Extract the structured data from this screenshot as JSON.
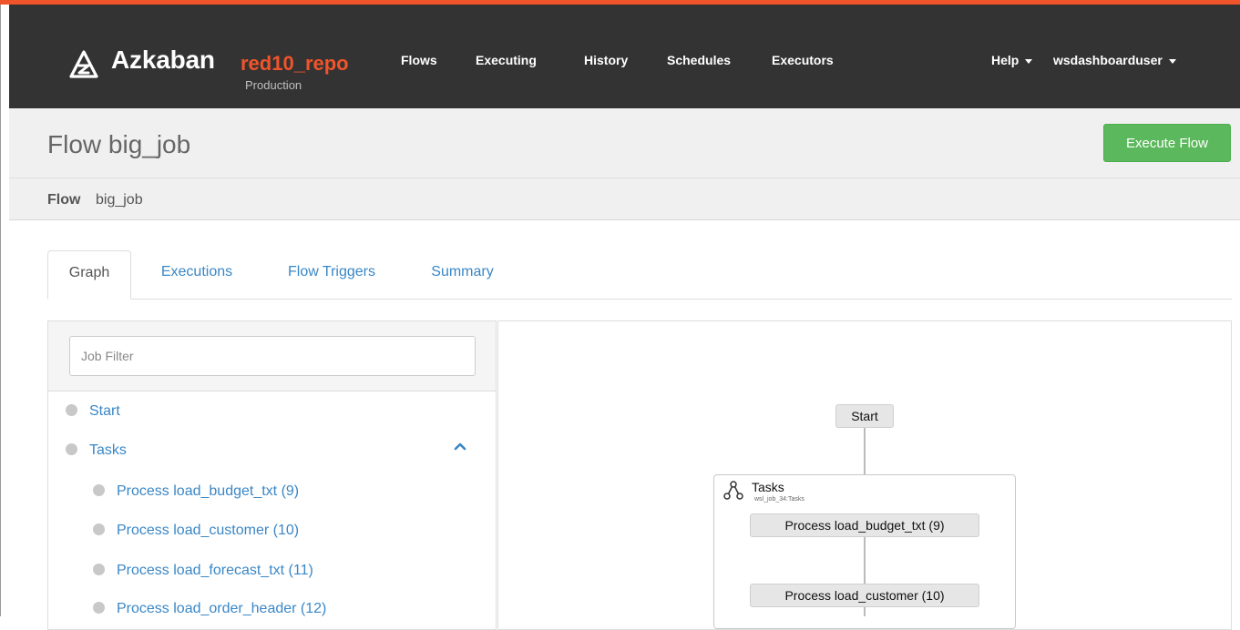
{
  "navbar": {
    "brand_name": "Azkaban",
    "project": "red10_repo",
    "environment": "Production",
    "items": [
      "Flows",
      "Executing",
      "History",
      "Schedules",
      "Executors"
    ],
    "help_label": "Help",
    "user_label": "wsdashboarduser"
  },
  "title_bar": {
    "title": "Flow big_job",
    "execute_label": "Execute Flow"
  },
  "breadcrumb": {
    "label": "Flow",
    "value": "big_job"
  },
  "tabs": [
    "Graph",
    "Executions",
    "Flow Triggers",
    "Summary"
  ],
  "job_list": {
    "filter_placeholder": "Job Filter",
    "items": [
      "Start",
      "Tasks",
      "Process load_budget_txt (9)",
      "Process load_customer (10)",
      "Process load_forecast_txt (11)",
      "Process load_order_header (12)"
    ]
  },
  "graph": {
    "start_label": "Start",
    "tasks_title": "Tasks",
    "tasks_subtitle": "wsl_job_34:Tasks",
    "nodes": [
      "Process load_budget_txt (9)",
      "Process load_customer (10)"
    ]
  },
  "colors": {
    "accent": "#f1542a",
    "navbar": "#333333",
    "link": "#3a87c6",
    "execute_button": "#5cb85c"
  }
}
